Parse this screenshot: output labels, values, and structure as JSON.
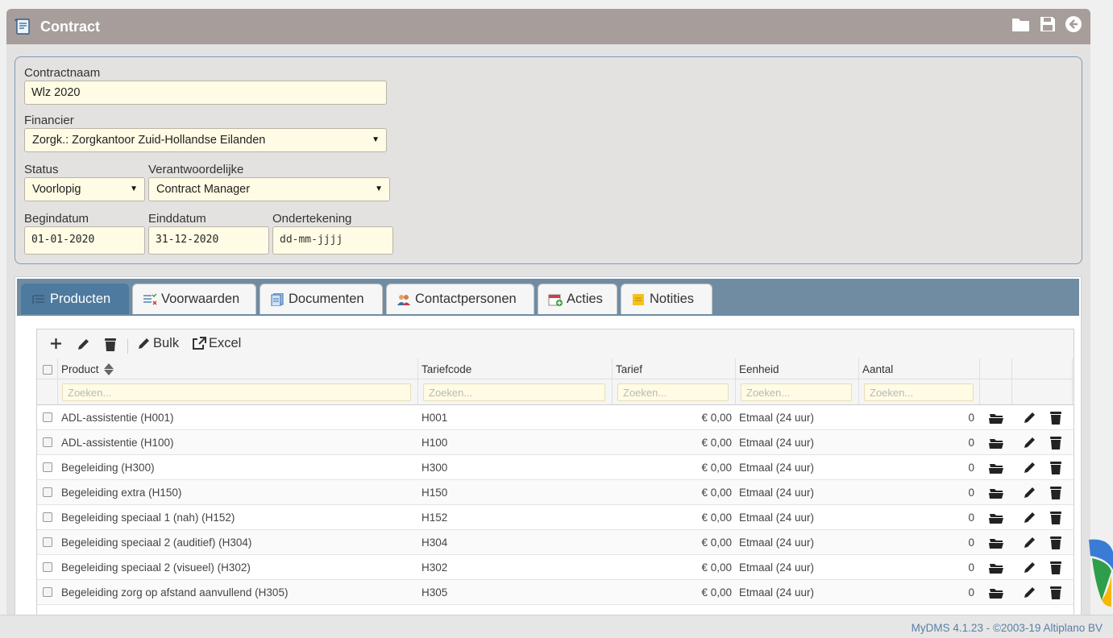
{
  "window": {
    "title": "Contract"
  },
  "form": {
    "contractnaam": {
      "label": "Contractnaam",
      "value": "Wlz 2020"
    },
    "financier": {
      "label": "Financier",
      "value": "Zorgk.: Zorgkantoor Zuid-Hollandse Eilanden"
    },
    "status": {
      "label": "Status",
      "value": "Voorlopig"
    },
    "verantwoordelijke": {
      "label": "Verantwoordelijke",
      "value": "Contract Manager"
    },
    "begindatum": {
      "label": "Begindatum",
      "value": "01-01-2020"
    },
    "einddatum": {
      "label": "Einddatum",
      "value": "31-12-2020"
    },
    "ondertekening": {
      "label": "Ondertekening",
      "placeholder": "dd-mm-jjjj"
    }
  },
  "tabs": [
    {
      "label": "Producten",
      "icon": "list-icon",
      "active": true
    },
    {
      "label": "Voorwaarden",
      "icon": "checklist-icon"
    },
    {
      "label": "Documenten",
      "icon": "document-icon"
    },
    {
      "label": "Contactpersonen",
      "icon": "contacts-icon"
    },
    {
      "label": "Acties",
      "icon": "calendar-add-icon"
    },
    {
      "label": "Notities",
      "icon": "note-icon"
    }
  ],
  "toolbar": {
    "bulk_label": "Bulk",
    "excel_label": "Excel"
  },
  "table": {
    "columns": [
      "Product",
      "Tariefcode",
      "Tarief",
      "Eenheid",
      "Aantal"
    ],
    "search_placeholder": "Zoeken...",
    "rows": [
      {
        "product": "ADL-assistentie (H001)",
        "code": "H001",
        "tarief": "€ 0,00",
        "eenheid": "Etmaal (24 uur)",
        "aantal": "0"
      },
      {
        "product": "ADL-assistentie (H100)",
        "code": "H100",
        "tarief": "€ 0,00",
        "eenheid": "Etmaal (24 uur)",
        "aantal": "0"
      },
      {
        "product": "Begeleiding (H300)",
        "code": "H300",
        "tarief": "€ 0,00",
        "eenheid": "Etmaal (24 uur)",
        "aantal": "0"
      },
      {
        "product": "Begeleiding extra (H150)",
        "code": "H150",
        "tarief": "€ 0,00",
        "eenheid": "Etmaal (24 uur)",
        "aantal": "0"
      },
      {
        "product": "Begeleiding speciaal 1 (nah) (H152)",
        "code": "H152",
        "tarief": "€ 0,00",
        "eenheid": "Etmaal (24 uur)",
        "aantal": "0"
      },
      {
        "product": "Begeleiding speciaal 2 (auditief) (H304)",
        "code": "H304",
        "tarief": "€ 0,00",
        "eenheid": "Etmaal (24 uur)",
        "aantal": "0"
      },
      {
        "product": "Begeleiding speciaal 2 (visueel) (H302)",
        "code": "H302",
        "tarief": "€ 0,00",
        "eenheid": "Etmaal (24 uur)",
        "aantal": "0"
      },
      {
        "product": "Begeleiding zorg op afstand aanvullend (H305)",
        "code": "H305",
        "tarief": "€ 0,00",
        "eenheid": "Etmaal (24 uur)",
        "aantal": "0"
      }
    ]
  },
  "footer": {
    "copyright": "MyDMS 4.1.23 - ©2003-19 Altiplano BV"
  },
  "colors": {
    "titlebar": "#a79d9a",
    "tabstrip": "#6f8ca3",
    "active_tab": "#4e7a9f",
    "input_bg": "#fffbe4",
    "footer_text": "#5a7fa6"
  }
}
